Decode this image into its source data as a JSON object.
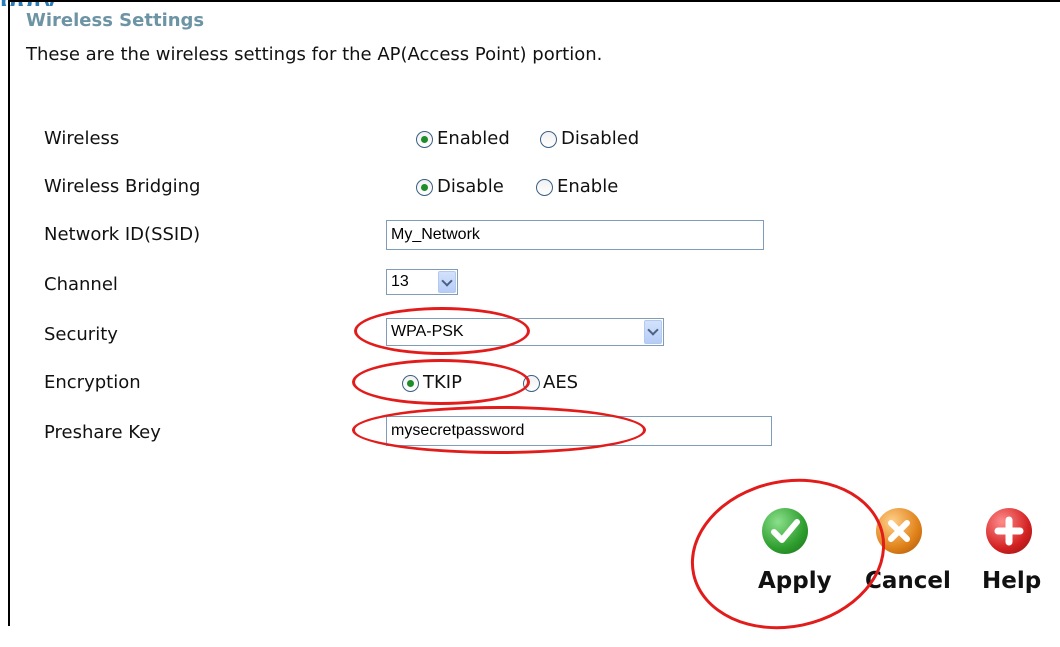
{
  "header_fragment": "pply",
  "section": {
    "title": "Wireless Settings",
    "description": "These are the wireless settings for the AP(Access Point) portion."
  },
  "form": {
    "wireless": {
      "label": "Wireless",
      "options": [
        "Enabled",
        "Disabled"
      ],
      "selected": "Enabled"
    },
    "bridging": {
      "label": "Wireless Bridging",
      "options": [
        "Disable",
        "Enable"
      ],
      "selected": "Disable"
    },
    "ssid": {
      "label": "Network ID(SSID)",
      "value": "My_Network"
    },
    "channel": {
      "label": "Channel",
      "value": "13"
    },
    "security": {
      "label": "Security",
      "value": "WPA-PSK"
    },
    "encryption": {
      "label": "Encryption",
      "options": [
        "TKIP",
        "AES"
      ],
      "selected": "TKIP"
    },
    "preshare": {
      "label": "Preshare Key",
      "value": "mysecretpassword"
    }
  },
  "buttons": {
    "apply": "Apply",
    "cancel": "Cancel",
    "help": "Help"
  },
  "colors": {
    "title": "#6d94a4",
    "annotation": "#e21b1b",
    "apply": "#2e9e2e",
    "cancel": "#e0821a",
    "help": "#d42222"
  },
  "icons": [
    "check-icon",
    "x-icon",
    "plus-icon",
    "chevron-down-icon"
  ]
}
